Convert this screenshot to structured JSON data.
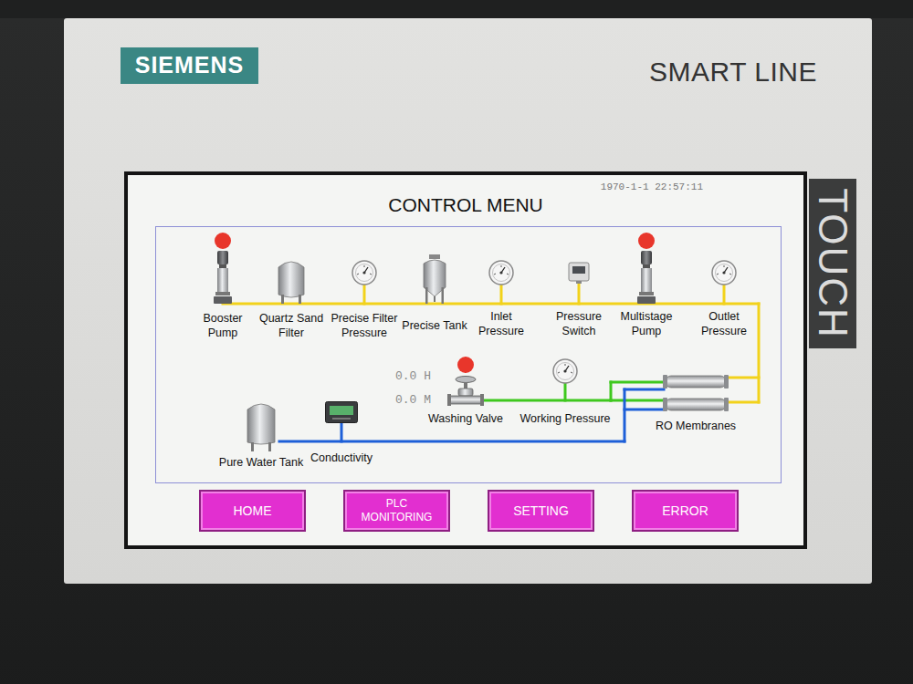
{
  "brand": "SIEMENS",
  "model": "SMART LINE",
  "touch_label": "TOUCH",
  "screen": {
    "datetime": "1970-1-1 22:57:11",
    "title": "CONTROL MENU",
    "components": [
      {
        "label": "Booster Pump",
        "kind": "pump",
        "indicator": true
      },
      {
        "label": "Quartz Sand Filter",
        "kind": "filter",
        "indicator": false
      },
      {
        "label": "Precise Filter Pressure",
        "kind": "gauge",
        "indicator": false
      },
      {
        "label": "Precise Tank",
        "kind": "vessel",
        "indicator": false
      },
      {
        "label": "Inlet Pressure",
        "kind": "gauge",
        "indicator": false
      },
      {
        "label": "Pressure Switch",
        "kind": "switch",
        "indicator": false
      },
      {
        "label": "Multistage Pump",
        "kind": "pump",
        "indicator": true
      },
      {
        "label": "Outlet Pressure",
        "kind": "gauge",
        "indicator": false
      },
      {
        "label": "Washing Valve",
        "kind": "valve",
        "indicator": true
      },
      {
        "label": "Working Pressure",
        "kind": "gauge",
        "indicator": false
      },
      {
        "label": "RO Membranes",
        "kind": "membrane",
        "indicator": false
      },
      {
        "label": "Pure Water Tank",
        "kind": "tank",
        "indicator": false
      },
      {
        "label": "Conductivity",
        "kind": "meter",
        "indicator": false
      }
    ],
    "timers": [
      "0.0 H",
      "0.0 M"
    ],
    "buttons": [
      "HOME",
      "PLC MONITORING",
      "SETTING",
      "ERROR"
    ]
  }
}
